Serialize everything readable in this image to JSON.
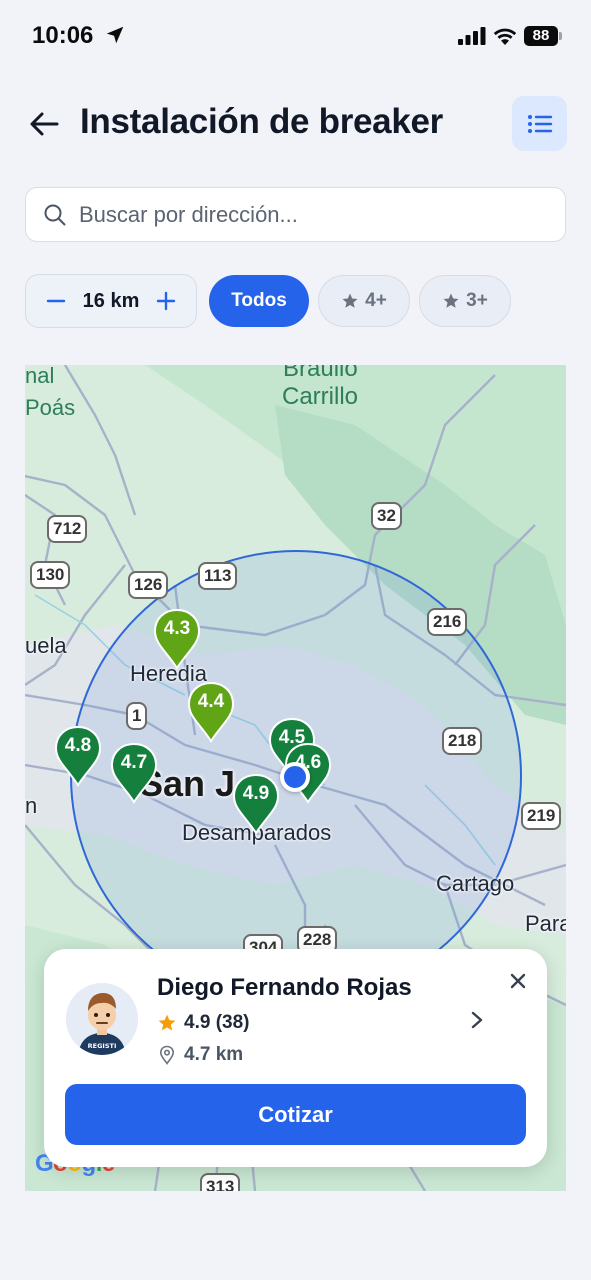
{
  "status_bar": {
    "time": "10:06",
    "battery": "88"
  },
  "header": {
    "title": "Instalación de breaker"
  },
  "search": {
    "placeholder": "Buscar por dirección..."
  },
  "filters": {
    "radius_value": "16 km",
    "chips": [
      {
        "label": "Todos",
        "active": true
      },
      {
        "label": "4+",
        "active": false
      },
      {
        "label": "3+",
        "active": false
      }
    ]
  },
  "map": {
    "place_labels": [
      "nal",
      "Poás",
      "Braulio",
      "Carrillo",
      "uela",
      "Heredia",
      "San J",
      "Desamparados",
      "Cartago",
      "Para",
      "n"
    ],
    "road_shields": [
      "712",
      "130",
      "126",
      "113",
      "32",
      "216",
      "1",
      "218",
      "219",
      "304",
      "228",
      "313"
    ],
    "pins": [
      {
        "rating": "4.3",
        "color": "#5fa516"
      },
      {
        "rating": "4.4",
        "color": "#5fa516"
      },
      {
        "rating": "4.8",
        "color": "#15803d"
      },
      {
        "rating": "4.7",
        "color": "#15803d"
      },
      {
        "rating": "4.5",
        "color": "#15803d"
      },
      {
        "rating": "4.6",
        "color": "#15803d"
      },
      {
        "rating": "4.9",
        "color": "#15803d"
      }
    ],
    "attribution": "Google"
  },
  "provider_card": {
    "name": "Diego Fernando Rojas",
    "rating": "4.9 (38)",
    "distance": "4.7 km",
    "avatar_badge": "REGISTI",
    "cta_label": "Cotizar"
  },
  "colors": {
    "primary": "#2563eb",
    "primary_light": "#dbe8fd",
    "pin_dark": "#15803d",
    "pin_light": "#5fa516",
    "star": "#f59e0b"
  }
}
